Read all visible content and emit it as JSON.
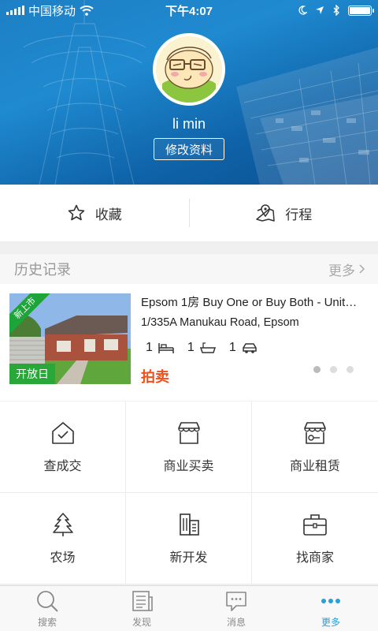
{
  "status_bar": {
    "carrier": "中国移动",
    "time": "下午4:07"
  },
  "profile": {
    "username": "li min",
    "edit_label": "修改资料"
  },
  "quick_actions": [
    {
      "label": "收藏",
      "icon": "star-icon"
    },
    {
      "label": "行程",
      "icon": "map-pin-icon"
    }
  ],
  "history": {
    "title": "历史记录",
    "more_label": "更多",
    "listing": {
      "ribbon": "新上市",
      "open_badge": "开放日",
      "title": "Epsom 1房 Buy One or Buy Both - Unit…",
      "address": "1/335A Manukau Road, Epsom",
      "bedrooms": "1",
      "bathrooms": "1",
      "parking": "1",
      "sale_type": "拍卖"
    },
    "pager": {
      "total": 3,
      "current": 1
    }
  },
  "grid_items": [
    {
      "label": "查成交",
      "icon": "house-check-icon"
    },
    {
      "label": "商业买卖",
      "icon": "shop-icon"
    },
    {
      "label": "商业租赁",
      "icon": "shop-key-icon"
    },
    {
      "label": "农场",
      "icon": "tree-icon"
    },
    {
      "label": "新开发",
      "icon": "building-icon"
    },
    {
      "label": "找商家",
      "icon": "briefcase-icon"
    }
  ],
  "tabs": [
    {
      "label": "搜索",
      "icon": "search-icon",
      "active": false
    },
    {
      "label": "发现",
      "icon": "newspaper-icon",
      "active": false
    },
    {
      "label": "消息",
      "icon": "message-icon",
      "active": false
    },
    {
      "label": "更多",
      "icon": "more-icon",
      "active": true
    }
  ],
  "colors": {
    "accent": "#2a9fd8",
    "header_blue": "#1f8ad0",
    "sale_orange": "#f04f1c",
    "badge_green": "#2aa739"
  }
}
